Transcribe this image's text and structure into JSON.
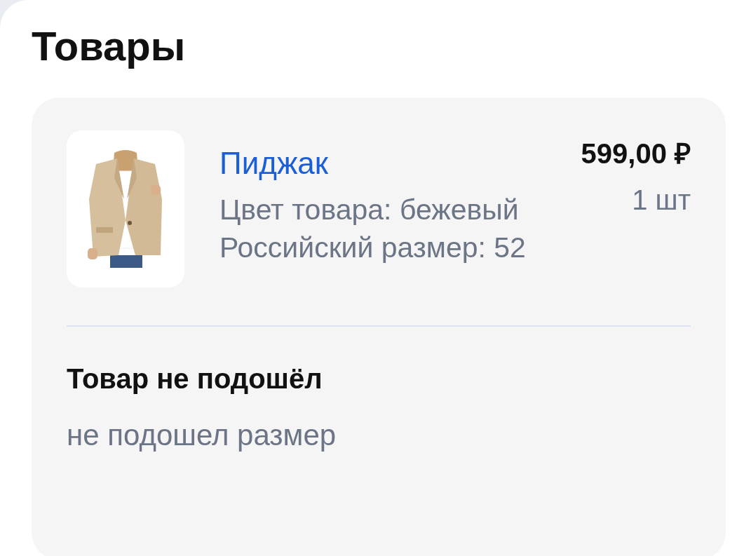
{
  "title": "Товары",
  "items": [
    {
      "name": "Пиджак",
      "attributes": [
        "Цвет товара: бежевый",
        "Российский размер: 52"
      ],
      "price": "599,00 ₽",
      "quantity": "1 шт"
    }
  ],
  "reason": {
    "title": "Товар не подошёл",
    "comment": "не подошел размер"
  }
}
